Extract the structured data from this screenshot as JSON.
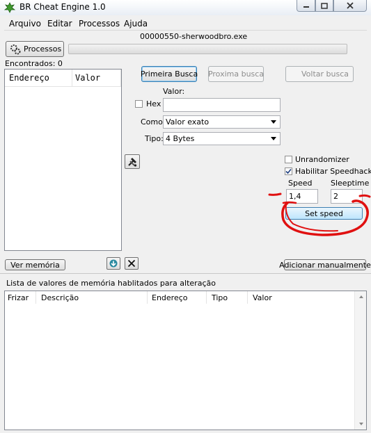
{
  "window": {
    "title": "BR Cheat Engine 1.0"
  },
  "menu": {
    "items": [
      "Arquivo",
      "Editar",
      "Processos",
      "Ajuda"
    ]
  },
  "process": {
    "name": "00000550-sherwoodbro.exe",
    "button_label": "Processos"
  },
  "found": {
    "label": "Encontrados: 0"
  },
  "results_list": {
    "columns": [
      "Endereço",
      "Valor"
    ]
  },
  "scan": {
    "first_scan": "Primeira Busca",
    "next_scan": "Proxima busca",
    "undo_scan": "Voltar busca",
    "value_label": "Valor:",
    "hex_label": "Hex",
    "hex_checked": false,
    "value_input": "",
    "como_label": "Como:",
    "como_value": "Valor exato",
    "tipo_label": "Tipo:",
    "tipo_value": "4 Bytes"
  },
  "options": {
    "unrandomizer_label": "Unrandomizer",
    "unrandomizer_checked": false,
    "speedhack_label": "Habilitar Speedhack",
    "speedhack_checked": true,
    "speed_label": "Speed",
    "speed_value": "1,4",
    "sleeptime_label": "Sleeptime",
    "sleeptime_value": "2",
    "set_speed_button": "Set speed"
  },
  "toolbar": {
    "view_memory": "Ver memória",
    "add_manually": "Adicionar manualmente"
  },
  "address_list": {
    "label": "Lista de valores de memória hablitados para alteração",
    "columns": [
      "Frizar",
      "Descrição",
      "Endereço",
      "Tipo",
      "Valor"
    ]
  },
  "colors": {
    "annotation": "#e01010",
    "selected_border": "#3c7fb1"
  }
}
